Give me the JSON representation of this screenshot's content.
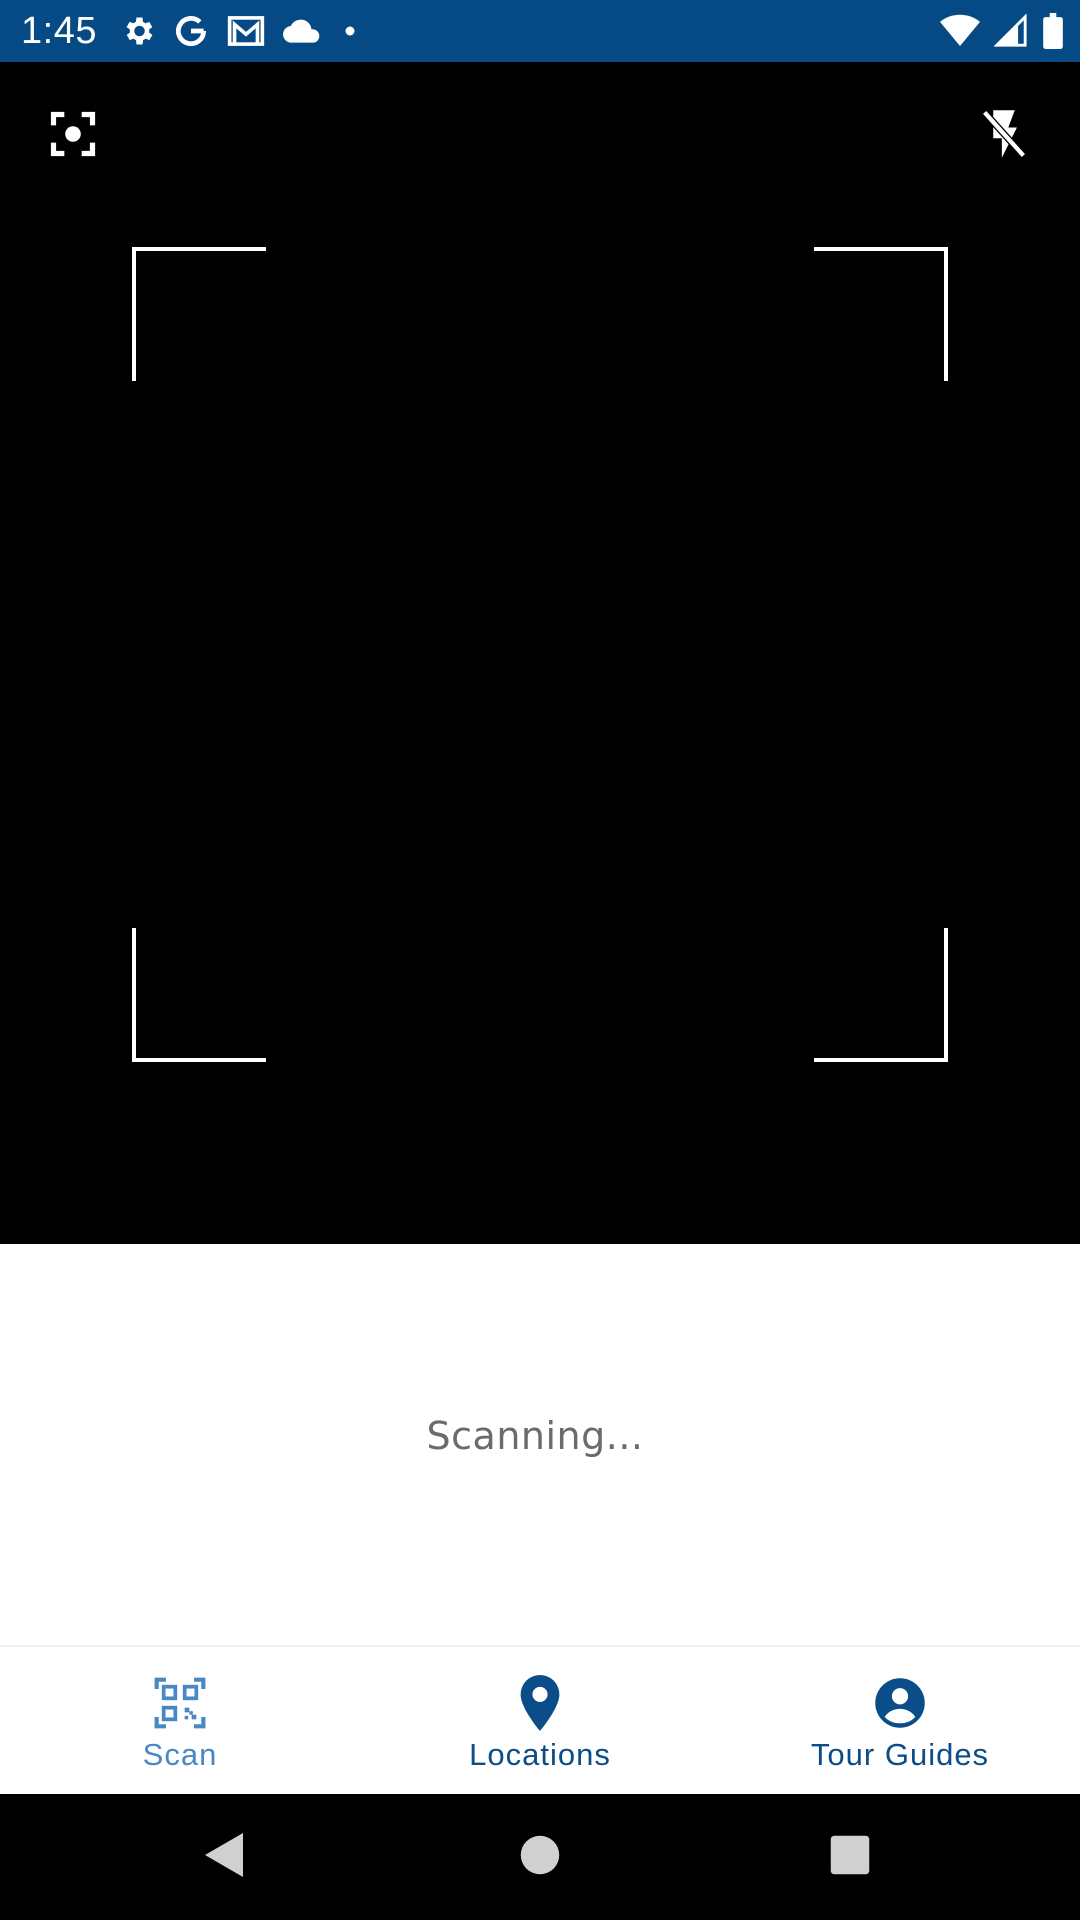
{
  "status_bar": {
    "time": "1:45",
    "icons_left": [
      "gear-icon",
      "google-icon",
      "gmail-icon",
      "cloud-icon",
      "dot-icon"
    ],
    "icons_right": [
      "wifi-icon",
      "signal-icon",
      "battery-icon"
    ],
    "background": "#064a85"
  },
  "camera": {
    "background": "#000000",
    "buttons": [
      "focus-icon",
      "flash-off-icon"
    ]
  },
  "scan_status": {
    "text": "Scanning..."
  },
  "bottom_nav": {
    "items": [
      {
        "label": "Scan",
        "icon": "qr-scan-icon",
        "active": true
      },
      {
        "label": "Locations",
        "icon": "location-pin-icon",
        "active": false
      },
      {
        "label": "Tour Guides",
        "icon": "account-circle-icon",
        "active": false
      }
    ],
    "active_color": "#4a88c5",
    "inactive_color": "#0b4d89"
  },
  "system_nav": {
    "buttons": [
      "back-icon",
      "home-icon",
      "recents-icon"
    ]
  }
}
